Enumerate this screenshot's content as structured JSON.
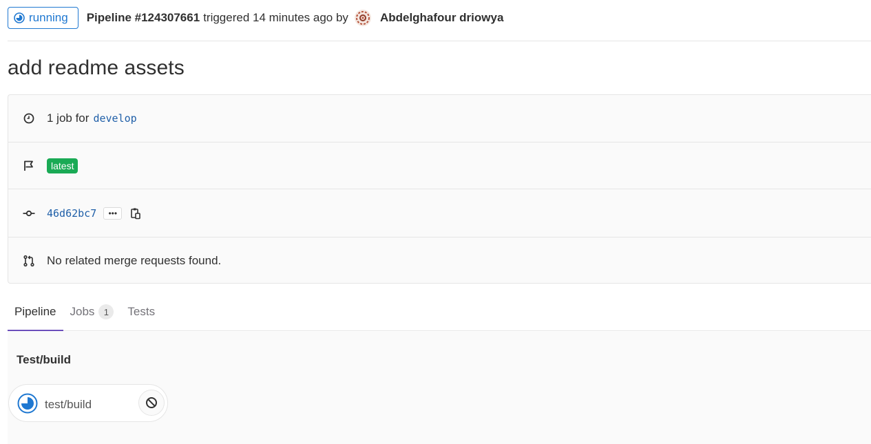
{
  "header": {
    "status_label": "running",
    "pipeline_id": "Pipeline #124307661",
    "triggered_text": "triggered 14 minutes ago by",
    "author": "Abdelghafour driowya"
  },
  "title": "add readme assets",
  "info": {
    "jobs_prefix": "1 job for",
    "branch": "develop",
    "badge_latest": "latest",
    "commit_sha": "46d62bc7",
    "ellipsis": "•••",
    "merge_requests": "No related merge requests found."
  },
  "tabs": [
    {
      "label": "Pipeline"
    },
    {
      "label": "Jobs",
      "count": "1"
    },
    {
      "label": "Tests"
    }
  ],
  "graph": {
    "stage": "Test/build",
    "job_name": "test/build"
  },
  "colors": {
    "running_blue": "#1f78d1",
    "latest_green": "#1aaa55",
    "tab_active": "#6b4fbb"
  },
  "icons": [
    "running-icon",
    "avatar",
    "clock-icon",
    "flag-icon",
    "commit-icon",
    "copy-icon",
    "merge-request-icon",
    "cancel-icon"
  ]
}
